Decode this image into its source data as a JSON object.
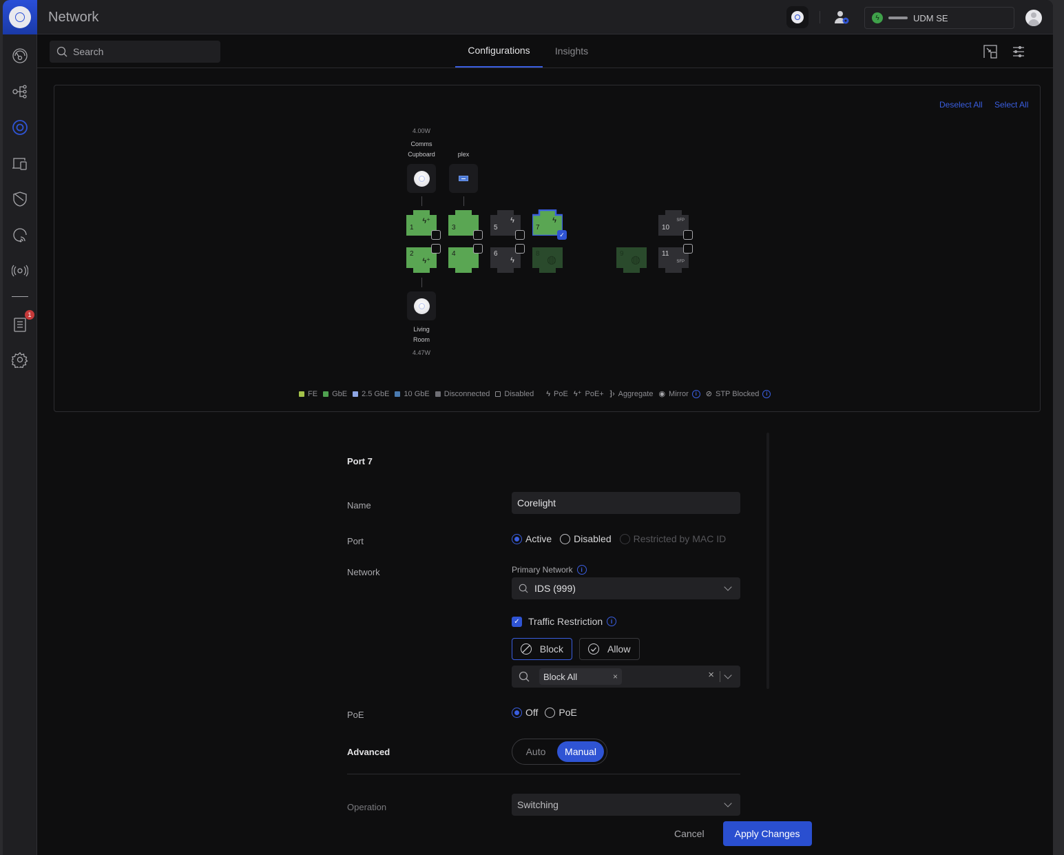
{
  "app": {
    "title": "Network"
  },
  "header": {
    "console_name": "UDM SE",
    "icons": [
      "unifi-device-icon",
      "admin-settings-icon",
      "power-icon",
      "avatar-icon"
    ]
  },
  "sidebar": {
    "items": [
      {
        "name": "dashboard",
        "icon": "dashboard-icon"
      },
      {
        "name": "topology",
        "icon": "topology-icon"
      },
      {
        "name": "unifi-devices",
        "icon": "unifi-devices-icon",
        "active": true
      },
      {
        "name": "client-devices",
        "icon": "client-devices-icon"
      },
      {
        "name": "security",
        "icon": "shield-icon"
      },
      {
        "name": "insights",
        "icon": "insights-icon"
      },
      {
        "name": "radios",
        "icon": "radio-icon"
      },
      {
        "name": "logs",
        "icon": "logs-icon",
        "badge": "1"
      },
      {
        "name": "settings",
        "icon": "gear-icon"
      }
    ]
  },
  "subbar": {
    "search_placeholder": "Search",
    "tabs": [
      {
        "label": "Configurations",
        "active": true
      },
      {
        "label": "Insights",
        "active": false
      }
    ]
  },
  "ports_panel": {
    "deselect_all": "Deselect All",
    "select_all": "Select All",
    "devices": [
      {
        "name_line1": "Comms",
        "name_line2": "Cupboard",
        "power": "4.00W",
        "port": 1,
        "type": "access-point"
      },
      {
        "name_line1": "",
        "name_line2": "plex",
        "power": "",
        "port": 3,
        "type": "server"
      },
      {
        "name_line1": "Living",
        "name_line2": "Room",
        "power": "4.47W",
        "port": 2,
        "type": "access-point"
      }
    ],
    "ports": [
      {
        "num": "1",
        "state": "GbE",
        "symbol": "PoE+",
        "selected": false
      },
      {
        "num": "2",
        "state": "GbE",
        "symbol": "PoE+",
        "selected": false
      },
      {
        "num": "3",
        "state": "GbE",
        "symbol": "",
        "selected": false
      },
      {
        "num": "4",
        "state": "GbE",
        "symbol": "",
        "selected": false
      },
      {
        "num": "5",
        "state": "Disconnected",
        "symbol": "PoE",
        "selected": false
      },
      {
        "num": "6",
        "state": "Disconnected",
        "symbol": "PoE",
        "selected": false
      },
      {
        "num": "7",
        "state": "GbE",
        "symbol": "PoE",
        "selected": true
      },
      {
        "num": "8",
        "state": "WAN",
        "symbol": "globe",
        "selected": false
      },
      {
        "num": "9",
        "state": "WAN",
        "symbol": "globe",
        "selected": false
      },
      {
        "num": "10",
        "state": "Disconnected",
        "symbol": "SFP",
        "selected": false
      },
      {
        "num": "11",
        "state": "Disconnected",
        "symbol": "SFP",
        "selected": false
      }
    ],
    "legend": [
      {
        "label": "FE",
        "color": "#a4c24a"
      },
      {
        "label": "GbE",
        "color": "#4fa150"
      },
      {
        "label": "2.5 GbE",
        "color": "#8ea6e4"
      },
      {
        "label": "10 GbE",
        "color": "#4a7ab0"
      },
      {
        "label": "Disconnected",
        "color": "#6e6e74"
      },
      {
        "label": "Disabled",
        "color": ""
      },
      {
        "label": "PoE",
        "icon": "bolt-icon"
      },
      {
        "label": "PoE+",
        "icon": "bolt-plus-icon"
      },
      {
        "label": "Aggregate",
        "icon": "aggregate-icon"
      },
      {
        "label": "Mirror",
        "icon": "eye-icon",
        "info": true
      },
      {
        "label": "STP Blocked",
        "icon": "blocked-icon",
        "info": true
      }
    ]
  },
  "form": {
    "title": "Port 7",
    "name_label": "Name",
    "name_value": "Corelight",
    "port_label": "Port",
    "port_options": [
      {
        "label": "Active",
        "checked": true,
        "disabled": false
      },
      {
        "label": "Disabled",
        "checked": false,
        "disabled": false
      },
      {
        "label": "Restricted by MAC ID",
        "checked": false,
        "disabled": true
      }
    ],
    "network_label": "Network",
    "primary_network_label": "Primary Network",
    "primary_network_value": "IDS (999)",
    "traffic_restriction_label": "Traffic Restriction",
    "traffic_restriction_checked": true,
    "block_label": "Block",
    "allow_label": "Allow",
    "restriction_mode": "Block",
    "restriction_tag": "Block All",
    "poe_label": "PoE",
    "poe_options": [
      {
        "label": "Off",
        "checked": true
      },
      {
        "label": "PoE",
        "checked": false
      }
    ],
    "advanced_label": "Advanced",
    "advanced_options": [
      {
        "label": "Auto",
        "active": false
      },
      {
        "label": "Manual",
        "active": true
      }
    ],
    "operation_label": "Operation",
    "operation_value": "Switching"
  },
  "footer": {
    "cancel": "Cancel",
    "apply": "Apply Changes"
  }
}
